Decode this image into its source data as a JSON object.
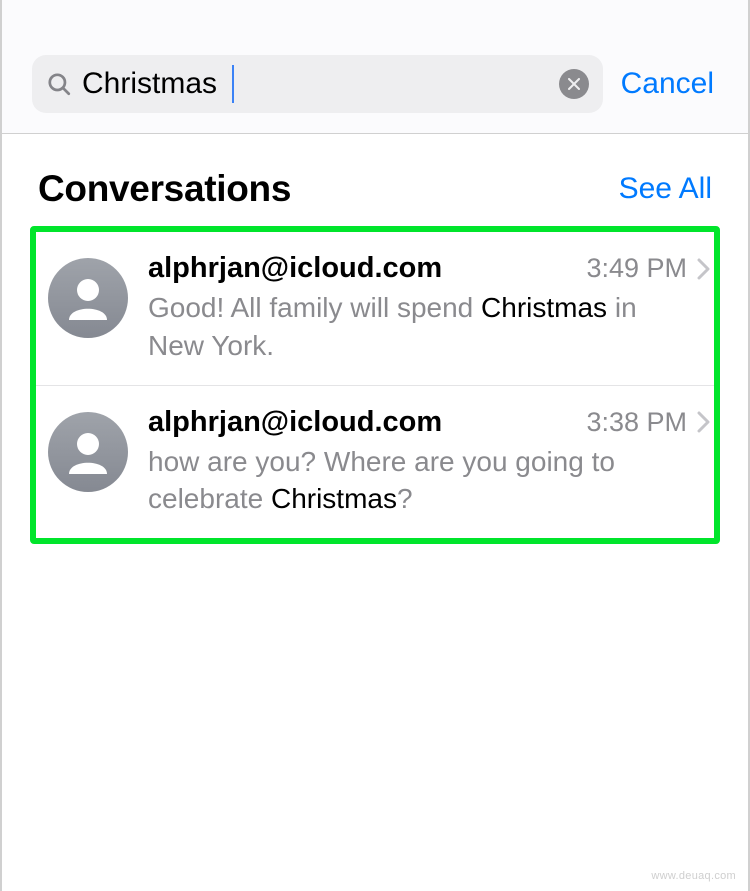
{
  "search": {
    "value": "Christmas",
    "cancel_label": "Cancel"
  },
  "section": {
    "title": "Conversations",
    "see_all_label": "See All"
  },
  "conversations": [
    {
      "sender": "alphrjan@icloud.com",
      "time": "3:49 PM",
      "preview_before": "Good! All family will spend ",
      "preview_match": "Christmas",
      "preview_after": " in New York."
    },
    {
      "sender": "alphrjan@icloud.com",
      "time": "3:38 PM",
      "preview_before": "how are you? Where are you going to celebrate ",
      "preview_match": "Christmas",
      "preview_after": "?"
    }
  ],
  "watermark": "www.deuaq.com"
}
